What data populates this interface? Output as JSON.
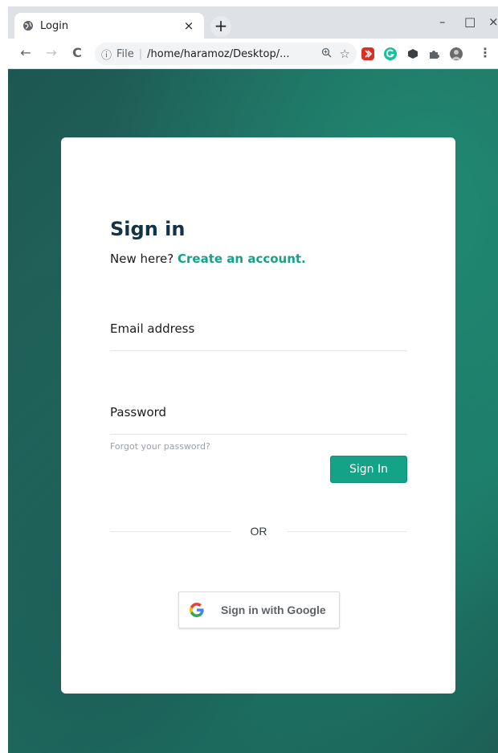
{
  "browser": {
    "tab": {
      "title": "Login",
      "close_glyph": "×"
    },
    "new_tab_glyph": "+",
    "window_controls": {
      "minimize": "–",
      "maximize": "□",
      "close": "×"
    },
    "nav": {
      "back": "←",
      "forward": "→",
      "reload": "C"
    },
    "address": {
      "info_glyph": "ⓘ",
      "scheme": "File",
      "separator": "|",
      "path": "/home/haramoz/Desktop/...",
      "zoom_icon": "zoom-icon",
      "bookmark_glyph": "☆"
    },
    "menu_glyph": "⋮"
  },
  "login": {
    "title": "Sign in",
    "subtitle_prefix": "New here?",
    "create_account_link": "Create an account.",
    "email_placeholder": "Email address",
    "password_placeholder": "Password",
    "forgot_password": "Forgot your password?",
    "signin_button": "Sign In",
    "or_text": "OR",
    "google_button": "Sign in with Google"
  },
  "colors": {
    "accent": "#14a386",
    "title": "#163247",
    "background_teal": "#226b60"
  }
}
